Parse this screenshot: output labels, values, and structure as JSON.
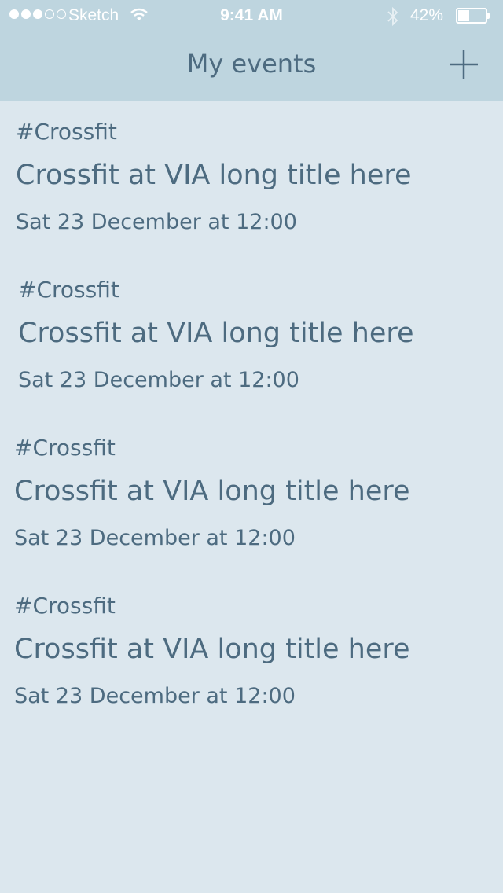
{
  "status_bar": {
    "carrier": "Sketch",
    "time": "9:41 AM",
    "battery_percent": "42%",
    "battery_level": 0.42,
    "signal_bars_filled": 3,
    "signal_bars_total": 5
  },
  "nav": {
    "title": "My events",
    "add_icon": "plus-icon"
  },
  "events": [
    {
      "tag": "#Crossfit",
      "title": "Crossfit at VIA long title here",
      "date": "Sat 23 December at 12:00"
    },
    {
      "tag": "#Crossfit",
      "title": "Crossfit at VIA long title here",
      "date": "Sat 23 December at 12:00"
    },
    {
      "tag": "#Crossfit",
      "title": "Crossfit at VIA long title here",
      "date": "Sat 23 December at 12:00"
    },
    {
      "tag": "#Crossfit",
      "title": "Crossfit at VIA long title here",
      "date": "Sat 23 December at 12:00"
    }
  ],
  "colors": {
    "header_bg": "#bed5df",
    "page_bg": "#dce7ee",
    "text": "#4d6b80",
    "divider": "#8ea3ad"
  }
}
